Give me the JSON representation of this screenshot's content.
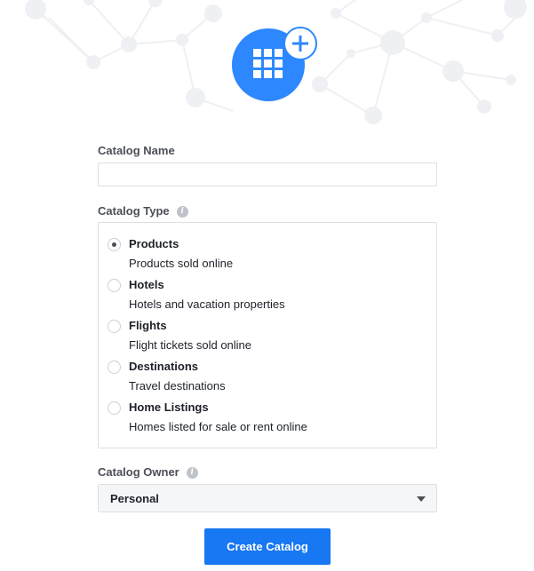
{
  "header": {
    "illustration_icon": "catalog-grid-icon",
    "add_icon": "plus-icon",
    "accent_color": "#2d88ff"
  },
  "form": {
    "name_label": "Catalog Name",
    "name_value": "",
    "type_label": "Catalog Type",
    "type_info_icon": "info-icon",
    "type_options": [
      {
        "title": "Products",
        "description": "Products sold online",
        "selected": true
      },
      {
        "title": "Hotels",
        "description": "Hotels and vacation properties",
        "selected": false
      },
      {
        "title": "Flights",
        "description": "Flight tickets sold online",
        "selected": false
      },
      {
        "title": "Destinations",
        "description": "Travel destinations",
        "selected": false
      },
      {
        "title": "Home Listings",
        "description": "Homes listed for sale or rent online",
        "selected": false
      }
    ],
    "owner_label": "Catalog Owner",
    "owner_info_icon": "info-icon",
    "owner_value": "Personal",
    "submit_label": "Create Catalog",
    "submit_color": "#1877f2"
  }
}
